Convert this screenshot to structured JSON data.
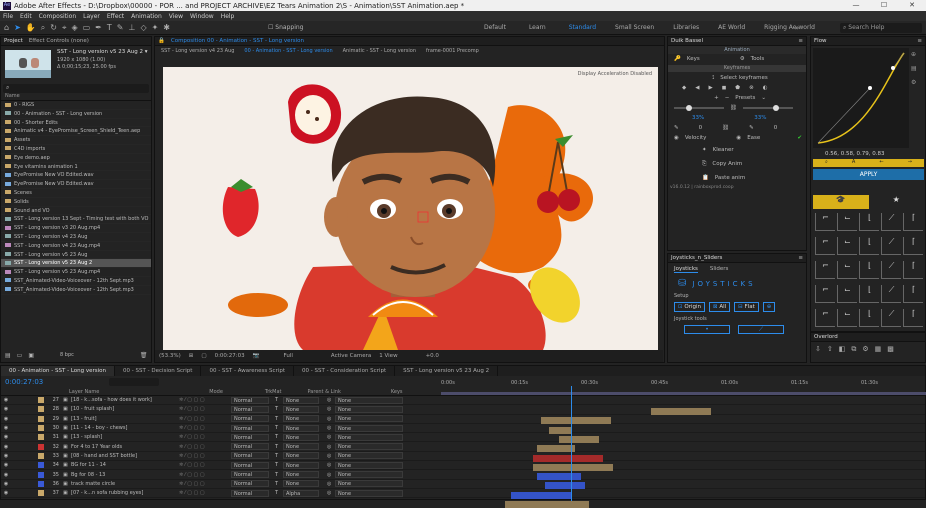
{
  "window": {
    "title": "Adobe After Effects - D:\\Dropbox\\00000 - POR ... and PROJECT ARCHIVE\\EZ Tears Animation 2\\S - Animation\\SST Animation.aep *",
    "controls": [
      "—",
      "☐",
      "✕"
    ]
  },
  "menu": [
    "File",
    "Edit",
    "Composition",
    "Layer",
    "Effect",
    "Animation",
    "View",
    "Window",
    "Help"
  ],
  "toolbar": {
    "snapping": "Snapping",
    "workspaces": [
      "Default",
      "Learn",
      "Standard",
      "Small Screen",
      "Libraries",
      "AE World",
      "Rigging Ae world"
    ],
    "active_workspace": "Standard",
    "search": "Search Help"
  },
  "project": {
    "tabs": [
      "Project",
      "Effect Controls (none)"
    ],
    "comp_name": "SST - Long version v5 23 Aug 2 ▾",
    "comp_info1": "1920 x 1080 (1.00)",
    "comp_info2": "Δ 0;00;15;23, 25.00 fps",
    "items": [
      {
        "name": "0 - RIGS",
        "icon": "folder",
        "color": "#c9a86a"
      },
      {
        "name": "00 - Animation - SST - Long version",
        "icon": "comp",
        "color": "#8aa"
      },
      {
        "name": "00 - Shorter Edits",
        "icon": "folder",
        "color": "#c9a86a"
      },
      {
        "name": "Animatic v4 - EyePromise_Screen_Shield_Teen.aep",
        "icon": "folder",
        "color": "#c9a86a"
      },
      {
        "name": "Assets",
        "icon": "folder",
        "color": "#c9a86a"
      },
      {
        "name": "C4D imports",
        "icon": "folder",
        "color": "#c9a86a"
      },
      {
        "name": "Eye demo.aep",
        "icon": "folder",
        "color": "#c9a86a"
      },
      {
        "name": "Eye vitamins animation 1",
        "icon": "folder",
        "color": "#c9a86a"
      },
      {
        "name": "EyePromise New VO Edited.wav",
        "icon": "audio",
        "color": "#7ad"
      },
      {
        "name": "EyePromise New VO Edited.wav",
        "icon": "audio",
        "color": "#7ad"
      },
      {
        "name": "Scenes",
        "icon": "folder",
        "color": "#c9a86a"
      },
      {
        "name": "Solids",
        "icon": "folder",
        "color": "#c9a86a"
      },
      {
        "name": "Sound and VO",
        "icon": "folder",
        "color": "#c9a86a"
      },
      {
        "name": "SST - Long version 13 Sept - Timing test with both VO",
        "icon": "comp",
        "color": "#8aa"
      },
      {
        "name": "SST - Long version v3 20 Aug.mp4",
        "icon": "video",
        "color": "#b8b"
      },
      {
        "name": "SST - Long version v4 23 Aug",
        "icon": "comp",
        "color": "#8aa"
      },
      {
        "name": "SST - Long version v4 23 Aug.mp4",
        "icon": "video",
        "color": "#b8b"
      },
      {
        "name": "SST - Long version v5 23 Aug",
        "icon": "comp",
        "color": "#8aa"
      },
      {
        "name": "SST - Long version v5 23 Aug 2",
        "icon": "comp",
        "color": "#8aa",
        "selected": true
      },
      {
        "name": "SST - Long version v5 23 Aug.mp4",
        "icon": "video",
        "color": "#b8b"
      },
      {
        "name": "SST_Animated-Video-Voiceover - 12th Sept.mp3",
        "icon": "audio",
        "color": "#7ad"
      },
      {
        "name": "SST_Animated-Video-Voiceover - 12th Sept.mp3",
        "icon": "audio",
        "color": "#7ad"
      }
    ],
    "bpc": "8 bpc"
  },
  "viewer": {
    "tab_title": "Composition 00 - Animation - SST - Long version",
    "crumbs": [
      "SST - Long version v4 23 Aug",
      "00 - Animation - SST - Long version",
      "Animatic - SST - Long version",
      "frame-0001 Precomp"
    ],
    "overlay": "Display Acceleration Disabled",
    "zoom": "(53.3%)",
    "time": "0:00:27:03",
    "quality": "Full",
    "camera": "Active Camera",
    "views": "1 View",
    "exposure": "+0.0"
  },
  "duik": {
    "title": "Duik Bassel",
    "sections": {
      "animation": "Animation",
      "keyframes": "Keyframes"
    },
    "keys": "Keys",
    "tools": "Tools",
    "select_keyframes": "Select keyframes",
    "presets": "Presets",
    "pct_left": "33%",
    "pct_right": "33%",
    "val_left": "0",
    "val_right": "0",
    "velocity": "Velocity",
    "ease": "Ease",
    "kleaner": "Kleaner",
    "copy_anim": "Copy Anim",
    "paste_anim": "Paste anim",
    "version": "v16.0.12 | rainboxprod.coop"
  },
  "joysticks": {
    "header": "Joysticks_n_Sliders",
    "tabs": [
      "Joysticks",
      "Sliders"
    ],
    "title": "JOYSTICKS",
    "setup": "Setup",
    "origin": "Origin",
    "all": "All",
    "flat": "Flat",
    "tools": "Joystick tools"
  },
  "flow": {
    "title": "Flow",
    "values": "0.56, 0.58, 0.79, 0.83",
    "apply": "APPLY",
    "overlord": "Overlord"
  },
  "timeline": {
    "tabs": [
      "00 - Animation - SST - Long version",
      "00 - SST - Decision Script",
      "00 - SST - Awareness Script",
      "00 - SST - Consideration Script",
      "SST - Long version v5 23 Aug 2"
    ],
    "timecode": "0:00:27:03",
    "columns": {
      "source": "Layer Name",
      "mode": "Mode",
      "trkmat": "TrkMat",
      "parent": "Parent & Link",
      "keys": "Keys"
    },
    "ruler": [
      "0:00s",
      "00:15s",
      "00:30s",
      "00:45s",
      "01:00s",
      "01:15s",
      "01:30s"
    ],
    "layers": [
      {
        "num": "27",
        "name": "[18 - k...sofa - how does it work]",
        "color": "#c9a86a",
        "mode": "Normal",
        "trk": "None",
        "parent": "None"
      },
      {
        "num": "28",
        "name": "[10 - fruit splash]",
        "color": "#c9a86a",
        "mode": "Normal",
        "trk": "None",
        "parent": "None"
      },
      {
        "num": "29",
        "name": "[13 - fruit]",
        "color": "#c9a86a",
        "mode": "Normal",
        "trk": "None",
        "parent": "None"
      },
      {
        "num": "30",
        "name": "[11 - 14 - boy - chews]",
        "color": "#c9a86a",
        "mode": "Normal",
        "trk": "None",
        "parent": "None"
      },
      {
        "num": "31",
        "name": "[13 - splash]",
        "color": "#c9a86a",
        "mode": "Normal",
        "trk": "None",
        "parent": "None"
      },
      {
        "num": "32",
        "name": "For 4 to 17 Year olds",
        "color": "#c33",
        "mode": "Normal",
        "trk": "None",
        "parent": "None"
      },
      {
        "num": "33",
        "name": "[08 - hand and SST bottle]",
        "color": "#c9a86a",
        "mode": "Normal",
        "trk": "None",
        "parent": "None"
      },
      {
        "num": "34",
        "name": "BG for 11 - 14",
        "color": "#3a5ad8",
        "mode": "Normal",
        "trk": "None",
        "parent": "None"
      },
      {
        "num": "35",
        "name": "Bg for 08 - 13",
        "color": "#3a5ad8",
        "mode": "Normal",
        "trk": "None",
        "parent": "None"
      },
      {
        "num": "36",
        "name": "track matte circle",
        "color": "#3a5ad8",
        "mode": "Normal",
        "trk": "None",
        "parent": "None"
      },
      {
        "num": "37",
        "name": "[07 - k...n sofa rubbing eyes]",
        "color": "#c9a86a",
        "mode": "Normal",
        "trk": "Alpha",
        "parent": "None"
      }
    ]
  },
  "colors": {
    "accent": "#2d8ceb",
    "apply": "#1e6ea8",
    "panel": "#232323"
  }
}
